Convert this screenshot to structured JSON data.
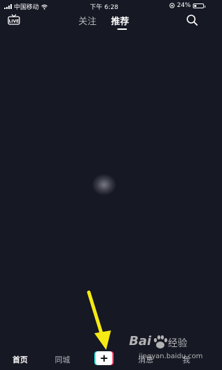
{
  "status_bar": {
    "carrier": "中国移动",
    "time": "下午 6:28",
    "battery": "24%",
    "battery_level": 0.24
  },
  "top_bar": {
    "live_label": "LIVE",
    "tabs": [
      {
        "label": "关注",
        "active": false
      },
      {
        "label": "推荐",
        "active": true
      }
    ]
  },
  "bottom_nav": {
    "items": [
      {
        "label": "首页",
        "active": true
      },
      {
        "label": "同城",
        "active": false
      },
      {
        "label": "+",
        "active": false
      },
      {
        "label": "消息",
        "active": false
      },
      {
        "label": "我",
        "active": false
      }
    ]
  },
  "watermark": {
    "brand": "Bai",
    "brand_suffix": "经验",
    "url": "jingyan.baidu.com"
  },
  "colors": {
    "background": "#161823",
    "plus_cyan": "#25f4ee",
    "plus_red": "#fe2c55",
    "arrow": "#f5ea13"
  }
}
